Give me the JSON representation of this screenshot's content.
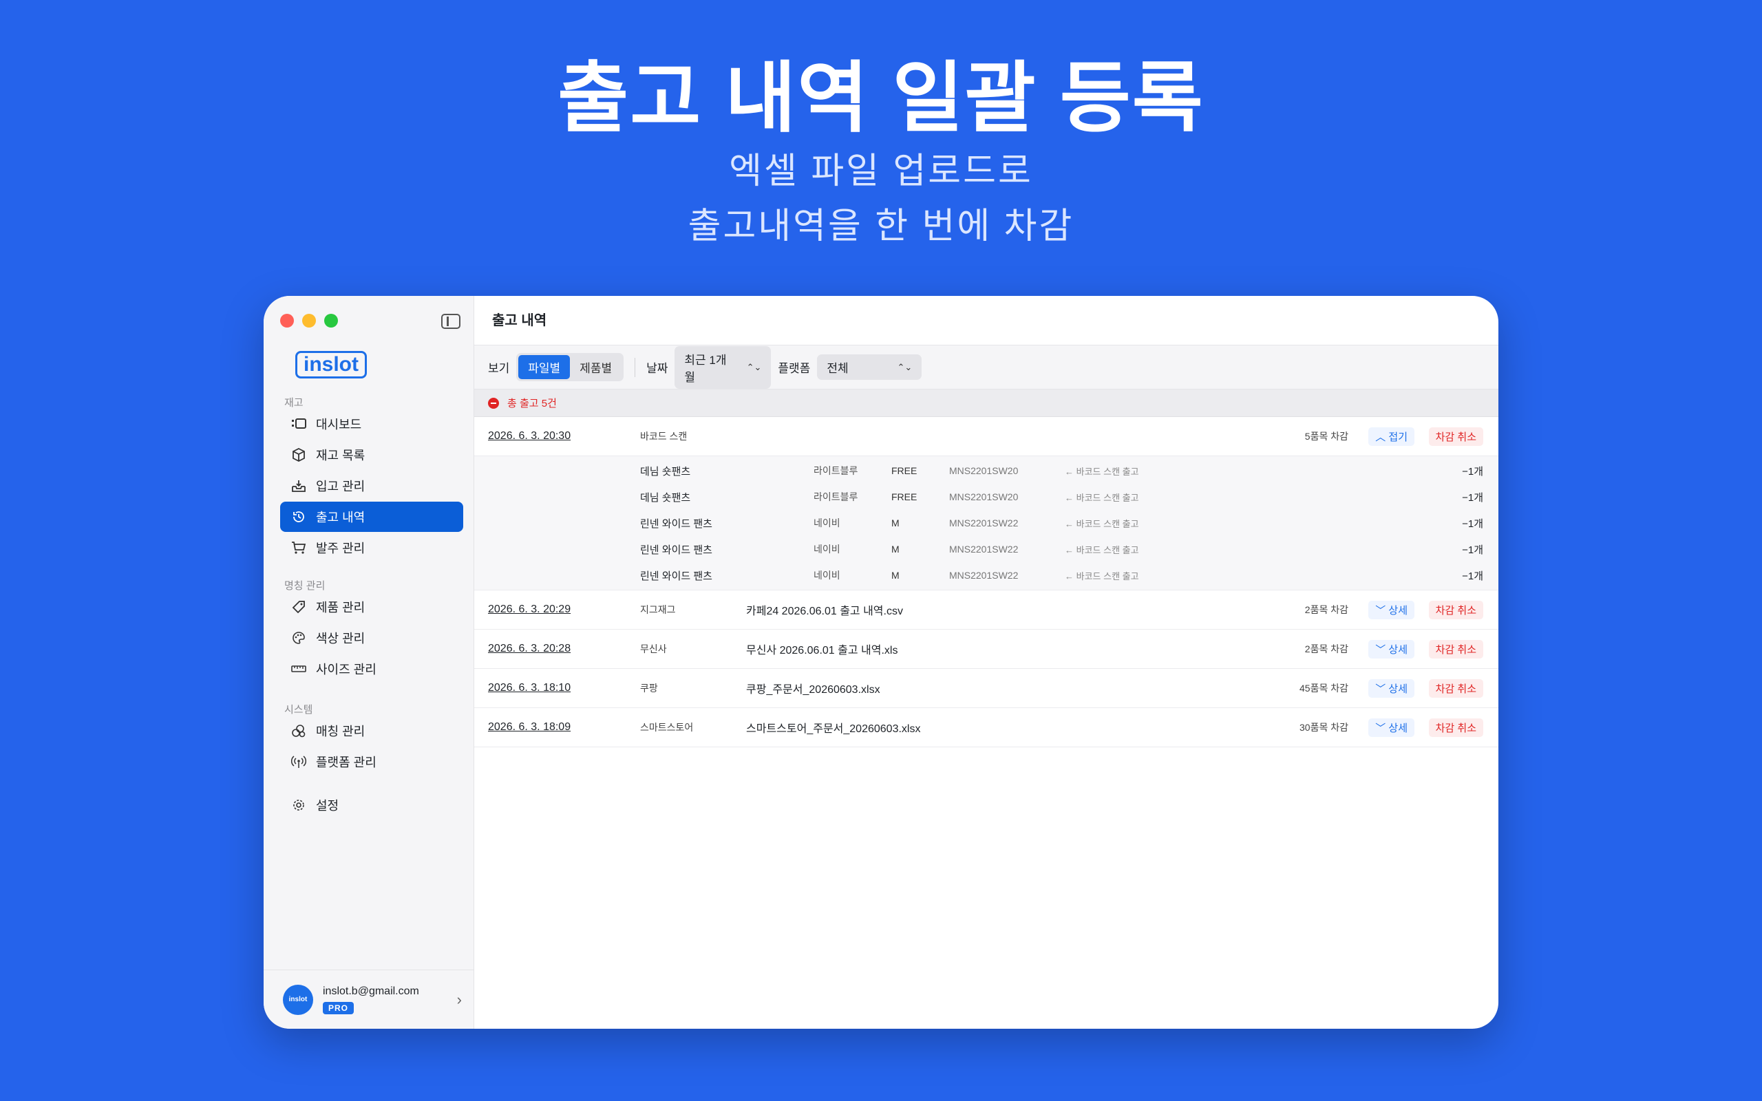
{
  "hero": {
    "title": "출고 내역 일괄 등록",
    "subtitle_line1": "엑셀 파일 업로드로",
    "subtitle_line2": "출고내역을 한 번에 차감"
  },
  "colors": {
    "background": "#2563eb",
    "accent": "#1d6fe8",
    "danger": "#e02424"
  },
  "sidebar": {
    "logo": "inslot",
    "sections": [
      {
        "label": "재고",
        "items": [
          {
            "label": "대시보드",
            "icon": "dashboard-icon"
          },
          {
            "label": "재고 목록",
            "icon": "box-icon"
          },
          {
            "label": "입고 관리",
            "icon": "inbox-icon"
          },
          {
            "label": "출고 내역",
            "icon": "history-icon",
            "active": true
          },
          {
            "label": "발주 관리",
            "icon": "cart-icon"
          }
        ]
      },
      {
        "label": "명칭 관리",
        "items": [
          {
            "label": "제품 관리",
            "icon": "tag-icon"
          },
          {
            "label": "색상 관리",
            "icon": "palette-icon"
          },
          {
            "label": "사이즈 관리",
            "icon": "ruler-icon"
          }
        ]
      },
      {
        "label": "시스템",
        "items": [
          {
            "label": "매칭 관리",
            "icon": "matching-icon"
          },
          {
            "label": "플랫폼 관리",
            "icon": "antenna-icon"
          }
        ]
      }
    ],
    "settings_label": "설정",
    "account": {
      "avatar_text": "inslot",
      "email": "inslot.b@gmail.com",
      "badge": "PRO"
    }
  },
  "main": {
    "title": "출고 내역",
    "toolbar": {
      "view_label": "보기",
      "view_options": [
        "파일별",
        "제품별"
      ],
      "view_selected": "파일별",
      "date_label": "날짜",
      "date_value": "최근 1개월",
      "platform_label": "플랫폼",
      "platform_value": "전체"
    },
    "summary": "총 출고 5건",
    "rows": [
      {
        "date": "2026. 6. 3. 20:30",
        "source": "바코드 스캔",
        "file": "",
        "count": "5품목 차감",
        "toggle": "접기",
        "cancel": "차감 취소",
        "items": [
          {
            "name": "데님 숏팬츠",
            "color": "라이트블루",
            "size": "FREE",
            "sku": "MNS2201SW20",
            "method": "← 바코드 스캔 출고",
            "qty": "−1개"
          },
          {
            "name": "데님 숏팬츠",
            "color": "라이트블루",
            "size": "FREE",
            "sku": "MNS2201SW20",
            "method": "← 바코드 스캔 출고",
            "qty": "−1개"
          },
          {
            "name": "린넨 와이드 팬츠",
            "color": "네이비",
            "size": "M",
            "sku": "MNS2201SW22",
            "method": "← 바코드 스캔 출고",
            "qty": "−1개"
          },
          {
            "name": "린넨 와이드 팬츠",
            "color": "네이비",
            "size": "M",
            "sku": "MNS2201SW22",
            "method": "← 바코드 스캔 출고",
            "qty": "−1개"
          },
          {
            "name": "린넨 와이드 팬츠",
            "color": "네이비",
            "size": "M",
            "sku": "MNS2201SW22",
            "method": "← 바코드 스캔 출고",
            "qty": "−1개"
          }
        ]
      },
      {
        "date": "2026. 6. 3. 20:29",
        "source": "지그재그",
        "file": "카페24 2026.06.01 출고 내역.csv",
        "count": "2품목 차감",
        "toggle": "상세",
        "cancel": "차감 취소"
      },
      {
        "date": "2026. 6. 3. 20:28",
        "source": "무신사",
        "file": "무신사 2026.06.01 출고 내역.xls",
        "count": "2품목 차감",
        "toggle": "상세",
        "cancel": "차감 취소"
      },
      {
        "date": "2026. 6. 3. 18:10",
        "source": "쿠팡",
        "file": "쿠팡_주문서_20260603.xlsx",
        "count": "45품목 차감",
        "toggle": "상세",
        "cancel": "차감 취소"
      },
      {
        "date": "2026. 6. 3. 18:09",
        "source": "스마트스토어",
        "file": "스마트스토어_주문서_20260603.xlsx",
        "count": "30품목 차감",
        "toggle": "상세",
        "cancel": "차감 취소"
      }
    ]
  }
}
